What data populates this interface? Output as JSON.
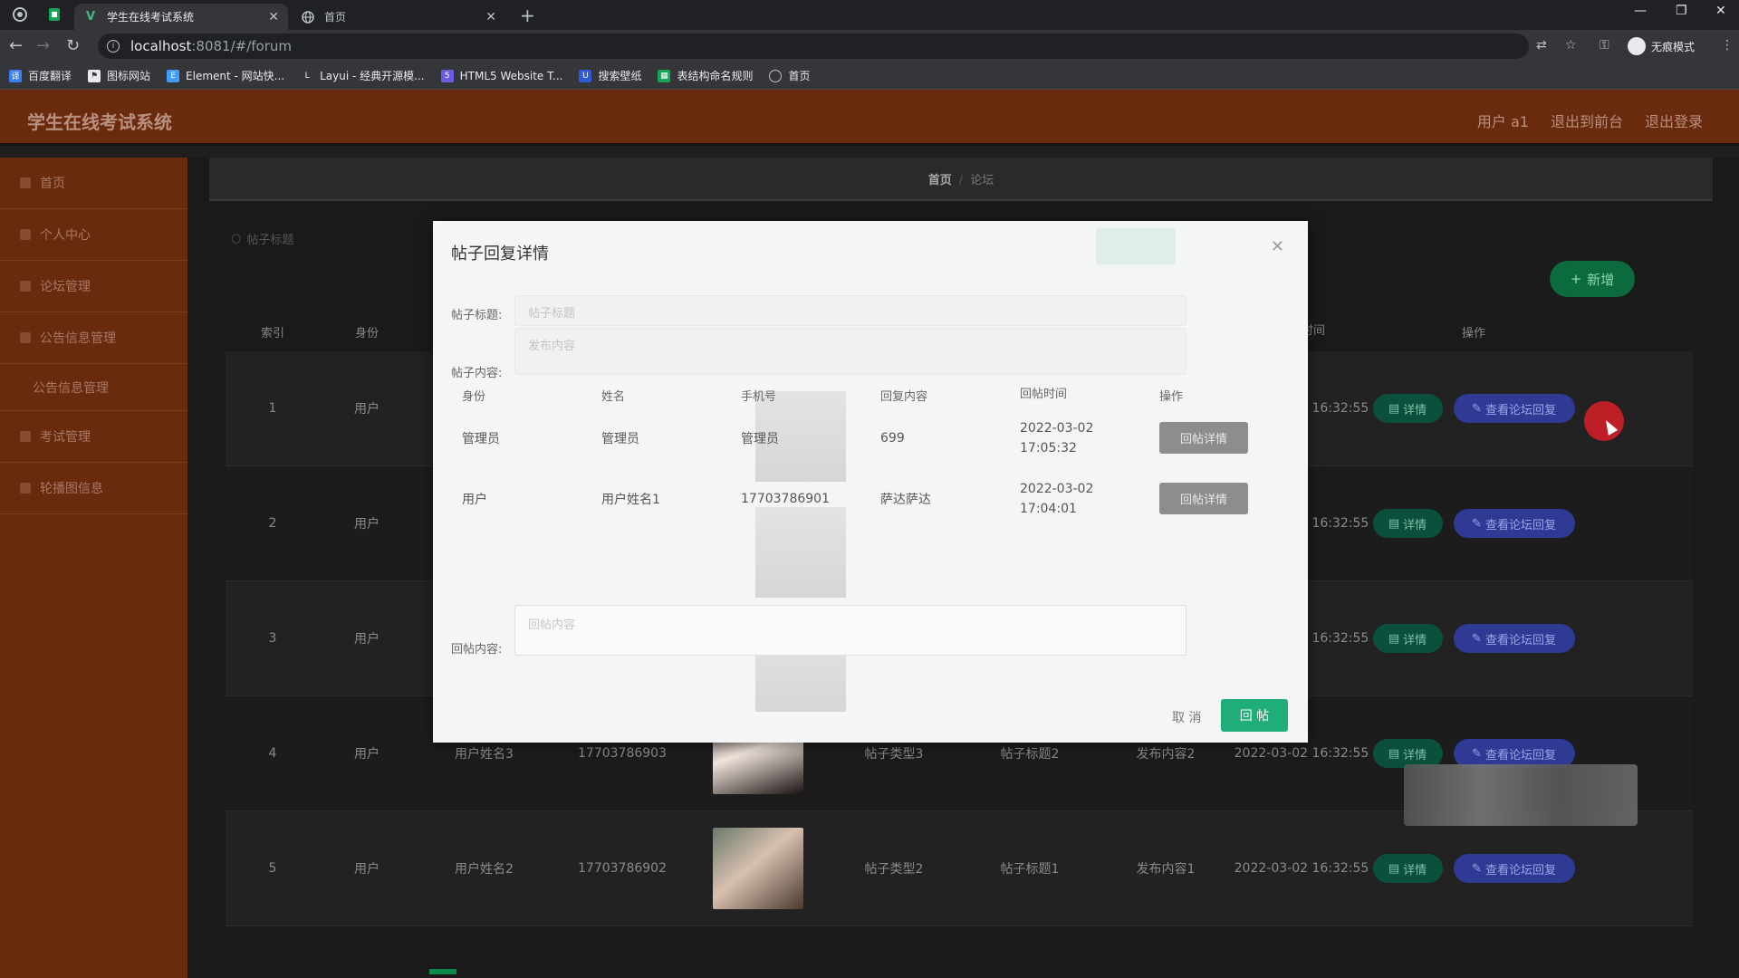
{
  "browser": {
    "tabs": [
      {
        "title": "学生在线考试系统",
        "favicon": "vue-icon",
        "favicon_color": "#42b883"
      },
      {
        "title": "首页",
        "favicon": "globe-icon",
        "favicon_color": "#bdc1c6"
      }
    ],
    "url_host": "localhost",
    "url_rest": ":8081/#/forum",
    "profile_label": "无痕模式",
    "bookmarks": [
      {
        "label": "百度翻译",
        "color": "#3b7df5"
      },
      {
        "label": "图标网站",
        "color": "#333333"
      },
      {
        "label": "Element - 网站快...",
        "color": "#409eff"
      },
      {
        "label": "Layui - 经典开源模...",
        "color": "#555555"
      },
      {
        "label": "HTML5 Website T...",
        "color": "#6b5be0"
      },
      {
        "label": "搜索壁纸",
        "color": "#2f5bd6"
      },
      {
        "label": "表结构命名规则",
        "color": "#1aa35a"
      },
      {
        "label": "首页",
        "color": "#777777"
      }
    ]
  },
  "app": {
    "title": "学生在线考试系统",
    "header_links": [
      "用户 a1",
      "退出到前台",
      "退出登录"
    ],
    "sidebar": [
      {
        "label": "首页",
        "type": "item"
      },
      {
        "label": "个人中心",
        "type": "item"
      },
      {
        "label": "论坛管理",
        "type": "item"
      },
      {
        "label": "公告信息管理",
        "type": "item"
      },
      {
        "label": "公告信息管理",
        "type": "sub"
      },
      {
        "label": "考试管理",
        "type": "item"
      },
      {
        "label": "轮播图信息",
        "type": "item"
      }
    ],
    "breadcrumb": {
      "home": "首页",
      "current": "论坛"
    },
    "search_placeholder": "帖子标题",
    "add_button": "新增",
    "table": {
      "headers": [
        "索引",
        "身份",
        "",
        "",
        "",
        "",
        "",
        "",
        "发帖时间",
        "操作"
      ],
      "rows": [
        {
          "idx": "1",
          "role": "用户",
          "name": "",
          "phone": "",
          "type": "",
          "ptitle": "",
          "content": "",
          "time": "2022-03-02 16:32:55"
        },
        {
          "idx": "2",
          "role": "用户",
          "name": "",
          "phone": "",
          "type": "",
          "ptitle": "",
          "content": "",
          "time": "2022-03-02 16:32:55"
        },
        {
          "idx": "3",
          "role": "用户",
          "name": "",
          "phone": "",
          "type": "",
          "ptitle": "",
          "content": "",
          "time": "2022-03-02 16:32:55"
        },
        {
          "idx": "4",
          "role": "用户",
          "name": "用户姓名3",
          "phone": "17703786903",
          "type": "帖子类型3",
          "ptitle": "帖子标题2",
          "content": "发布内容2",
          "time": "2022-03-02 16:32:55"
        },
        {
          "idx": "5",
          "role": "用户",
          "name": "用户姓名2",
          "phone": "17703786902",
          "type": "帖子类型2",
          "ptitle": "帖子标题1",
          "content": "发布内容1",
          "time": "2022-03-02 16:32:55"
        }
      ],
      "detail_button": "详情",
      "reply_button": "查看论坛回复"
    }
  },
  "modal": {
    "title": "帖子回复详情",
    "post_title_label": "帖子标题:",
    "post_title_placeholder": "帖子标题",
    "post_content_label": "帖子内容:",
    "post_content_placeholder": "发布内容",
    "reply_table": {
      "headers": [
        "身份",
        "姓名",
        "手机号",
        "回复内容",
        "回帖时间",
        "操作"
      ],
      "rows": [
        {
          "role": "管理员",
          "name": "管理员",
          "phone": "管理员",
          "content": "699",
          "time": "2022-03-02 17:05:32"
        },
        {
          "role": "用户",
          "name": "用户姓名1",
          "phone": "17703786901",
          "content": "萨达萨达",
          "time": "2022-03-02 17:04:01"
        }
      ],
      "op_button": "回帖详情"
    },
    "reply_label": "回帖内容:",
    "reply_placeholder": "回帖内容",
    "cancel_button": "取 消",
    "submit_button": "回 帖"
  }
}
